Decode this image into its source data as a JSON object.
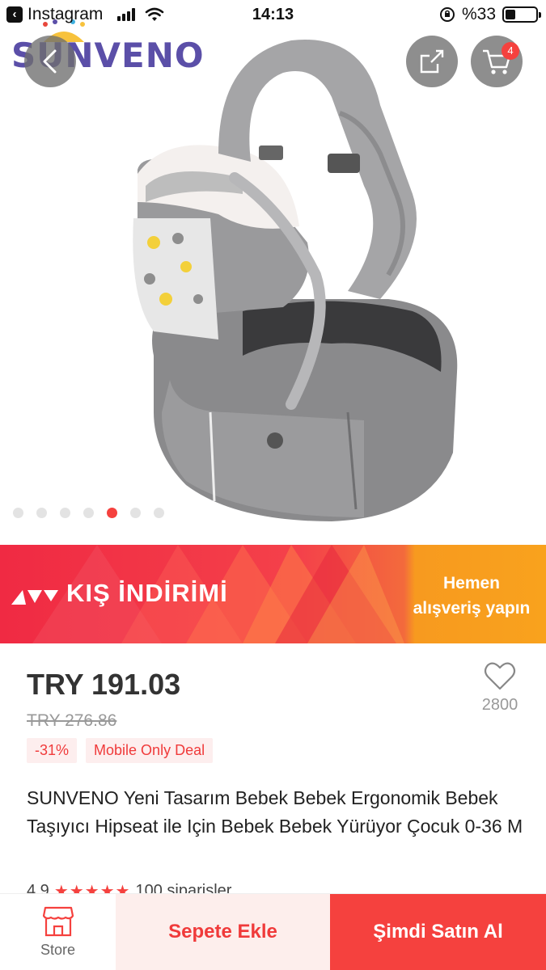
{
  "status_bar": {
    "back_app": "Instagram",
    "time": "14:13",
    "battery": "%33",
    "battery_level": 0.33
  },
  "header": {
    "brand": "SUNVENO",
    "cart_count": "4"
  },
  "gallery": {
    "total_images": 7,
    "active_index": 4
  },
  "banner": {
    "title": "KIŞ İNDİRİMİ",
    "cta_line1": "Hemen",
    "cta_line2": "alışveriş yapın"
  },
  "product": {
    "price": "TRY 191.03",
    "old_price": "TRY 276.86",
    "discount": "-31%",
    "deal": "Mobile Only Deal",
    "wishlist_count": "2800",
    "title": "SUNVENO Yeni Tasarım Bebek Bebek Ergonomik Bebek Taşıyıcı Hipseat ile Için Bebek Bebek Yürüyor Çocuk 0-36 M",
    "rating": "4.9",
    "stars": "★★★★★",
    "orders": "100 siparişler"
  },
  "actions": {
    "store_label": "Store",
    "add_to_cart": "Sepete Ekle",
    "buy_now": "Şimdi Satın Al"
  },
  "colors": {
    "accent": "#f5413e",
    "banner_orange": "#f9a21d",
    "brand_purple": "#5b4fa8"
  }
}
